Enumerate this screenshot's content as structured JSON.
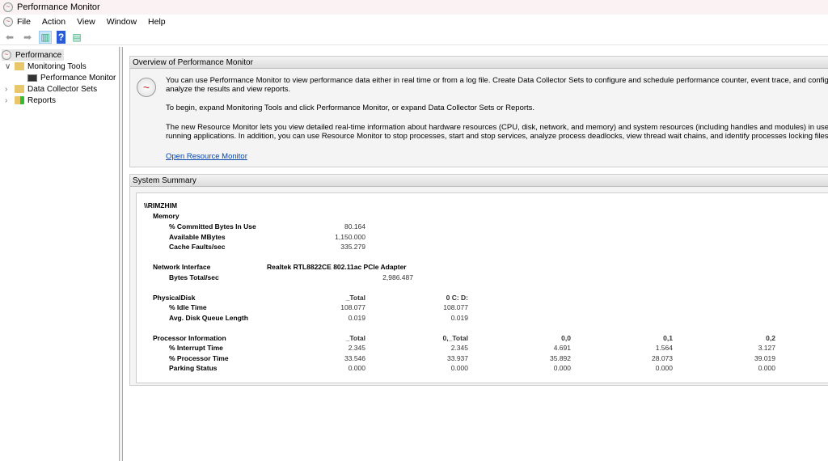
{
  "window": {
    "title": "Performance Monitor"
  },
  "menu": [
    "File",
    "Action",
    "View",
    "Window",
    "Help"
  ],
  "tree": {
    "root": "Performance",
    "items": [
      {
        "label": "Monitoring Tools",
        "expanded": true
      },
      {
        "label": "Performance Monitor"
      },
      {
        "label": "Data Collector Sets"
      },
      {
        "label": "Reports"
      }
    ]
  },
  "overview": {
    "title": "Overview of Performance Monitor",
    "p1a": "You can use Performance Monitor to view performance data either in real time or from a log file. Create Data Collector Sets to configure and schedule performance counter, event trace, and configura",
    "p1b": "analyze the results and view reports.",
    "p2": "To begin, expand Monitoring Tools and click Performance Monitor, or expand Data Collector Sets or Reports.",
    "p3a": "The new Resource Monitor lets you view detailed real-time information about hardware resources (CPU, disk, network, and memory) and system resources (including handles and modules) in use by t",
    "p3b": "running applications. In addition, you can use Resource Monitor to stop processes, start and stop services, analyze process deadlocks, view thread wait chains, and identify processes locking files.",
    "link": "Open Resource Monitor"
  },
  "summary": {
    "title": "System Summary",
    "host": "\\\\RIMZHIM",
    "memory": {
      "label": "Memory",
      "rows": [
        [
          "% Committed Bytes In Use",
          "80.164"
        ],
        [
          "Available MBytes",
          "1,150.000"
        ],
        [
          "Cache Faults/sec",
          "335.279"
        ]
      ]
    },
    "network": {
      "label": "Network Interface",
      "adapter": "Realtek RTL8822CE 802.11ac PCIe Adapter",
      "rows": [
        [
          "Bytes Total/sec",
          "2,986.487"
        ]
      ]
    },
    "disk": {
      "label": "PhysicalDisk",
      "cols": [
        "_Total",
        "0 C: D:"
      ],
      "rows": [
        [
          "% Idle Time",
          "108.077",
          "108.077"
        ],
        [
          "Avg. Disk Queue Length",
          "0.019",
          "0.019"
        ]
      ]
    },
    "processor": {
      "label": "Processor Information",
      "cols": [
        "_Total",
        "0,_Total",
        "0,0",
        "0,1",
        "0,2"
      ],
      "rows": [
        [
          "% Interrupt Time",
          "2.345",
          "2.345",
          "4.691",
          "1.564",
          "3.127"
        ],
        [
          "% Processor Time",
          "33.546",
          "33.937",
          "35.892",
          "28.073",
          "39.019"
        ],
        [
          "Parking Status",
          "0.000",
          "0.000",
          "0.000",
          "0.000",
          "0.000"
        ]
      ]
    }
  }
}
